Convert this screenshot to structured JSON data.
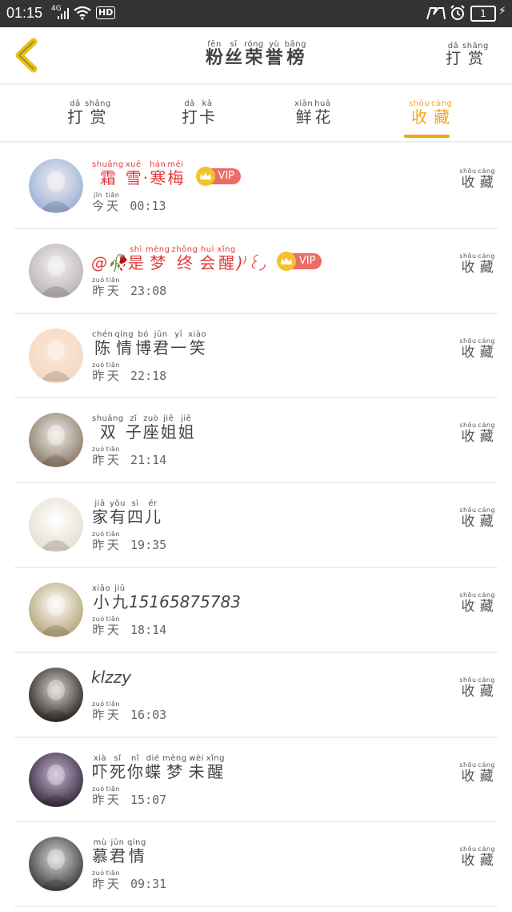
{
  "status_bar": {
    "time": "01:15",
    "signal_label": "4G",
    "hd_label": "HD",
    "battery": "1"
  },
  "header": {
    "title": [
      {
        "py": "fěn",
        "hz": "粉"
      },
      {
        "py": "sī",
        "hz": "丝"
      },
      {
        "py": "róng",
        "hz": "荣"
      },
      {
        "py": "yù",
        "hz": "誉"
      },
      {
        "py": "bǎng",
        "hz": "榜"
      }
    ],
    "reward_button": [
      {
        "py": "dǎ",
        "hz": "打"
      },
      {
        "py": "shǎng",
        "hz": "赏"
      }
    ]
  },
  "tabs": [
    {
      "chars": [
        {
          "py": "dǎ",
          "hz": "打"
        },
        {
          "py": "shǎng",
          "hz": "赏"
        }
      ]
    },
    {
      "chars": [
        {
          "py": "dǎ",
          "hz": "打"
        },
        {
          "py": "kǎ",
          "hz": "卡"
        }
      ]
    },
    {
      "chars": [
        {
          "py": "xiān",
          "hz": "鲜"
        },
        {
          "py": "huā",
          "hz": "花"
        }
      ]
    },
    {
      "chars": [
        {
          "py": "shōu",
          "hz": "收"
        },
        {
          "py": "cáng",
          "hz": "藏"
        }
      ]
    }
  ],
  "active_tab_index": 3,
  "accent_color": "#f4a51c",
  "collect_label": [
    {
      "py": "shōu",
      "hz": "收"
    },
    {
      "py": "cáng",
      "hz": "藏"
    }
  ],
  "day_today": [
    {
      "py": "jīn",
      "hz": "今"
    },
    {
      "py": "tiān",
      "hz": "天"
    }
  ],
  "day_yesterday": [
    {
      "py": "zuó",
      "hz": "昨"
    },
    {
      "py": "tiān",
      "hz": "天"
    }
  ],
  "vip_label": "VIP",
  "rows": [
    {
      "name": [
        {
          "py": "shuāng",
          "hz": "霜"
        },
        {
          "py": "xuě",
          "hz": "雪"
        },
        {
          "py": "",
          "hz": "·"
        },
        {
          "py": "hán",
          "hz": "寒"
        },
        {
          "py": "méi",
          "hz": "梅"
        }
      ],
      "name_color": "red",
      "vip": true,
      "day": "today",
      "time": "00:13"
    },
    {
      "name_prefix": "@🥀",
      "name": [
        {
          "py": "shì",
          "hz": "是"
        },
        {
          "py": "mèng",
          "hz": "梦"
        },
        {
          "py": "zhōng",
          "hz": "终"
        },
        {
          "py": "huì",
          "hz": "会"
        },
        {
          "py": "xǐng",
          "hz": "醒"
        }
      ],
      "name_suffix": ")⁾꒰◞",
      "name_color": "red",
      "vip": true,
      "day": "yesterday",
      "time": "23:08"
    },
    {
      "name": [
        {
          "py": "chén",
          "hz": "陈"
        },
        {
          "py": "qíng",
          "hz": "情"
        },
        {
          "py": "bó",
          "hz": "博"
        },
        {
          "py": "jūn",
          "hz": "君"
        },
        {
          "py": "yī",
          "hz": "一"
        },
        {
          "py": "xiào",
          "hz": "笑"
        }
      ],
      "name_color": "normal",
      "vip": false,
      "day": "yesterday",
      "time": "22:18"
    },
    {
      "name": [
        {
          "py": "shuāng",
          "hz": "双"
        },
        {
          "py": "zǐ",
          "hz": "子"
        },
        {
          "py": "zuò",
          "hz": "座"
        },
        {
          "py": "jiě",
          "hz": "姐"
        },
        {
          "py": "jiě",
          "hz": "姐"
        }
      ],
      "name_color": "normal",
      "vip": false,
      "day": "yesterday",
      "time": "21:14"
    },
    {
      "name": [
        {
          "py": "jiā",
          "hz": "家"
        },
        {
          "py": "yǒu",
          "hz": "有"
        },
        {
          "py": "sì",
          "hz": "四"
        },
        {
          "py": "ér",
          "hz": "儿"
        }
      ],
      "name_color": "normal",
      "vip": false,
      "day": "yesterday",
      "time": "19:35"
    },
    {
      "name": [
        {
          "py": "xiǎo",
          "hz": "小"
        },
        {
          "py": "jiǔ",
          "hz": "九"
        }
      ],
      "name_suffix": "15165875783",
      "name_color": "normal",
      "vip": false,
      "day": "yesterday",
      "time": "18:14"
    },
    {
      "name": [],
      "name_suffix": "klzzy",
      "name_color": "normal",
      "vip": false,
      "day": "yesterday",
      "time": "16:03"
    },
    {
      "name": [
        {
          "py": "xià",
          "hz": "吓"
        },
        {
          "py": "sǐ",
          "hz": "死"
        },
        {
          "py": "nǐ",
          "hz": "你"
        },
        {
          "py": "dié",
          "hz": "蝶"
        },
        {
          "py": "mèng",
          "hz": "梦"
        },
        {
          "py": "wèi",
          "hz": "未"
        },
        {
          "py": "xǐng",
          "hz": "醒"
        }
      ],
      "name_color": "normal",
      "vip": false,
      "day": "yesterday",
      "time": "15:07"
    },
    {
      "name": [
        {
          "py": "mù",
          "hz": "慕"
        },
        {
          "py": "jūn",
          "hz": "君"
        },
        {
          "py": "qíng",
          "hz": "情"
        }
      ],
      "name_color": "normal",
      "vip": false,
      "day": "yesterday",
      "time": "09:31"
    }
  ]
}
